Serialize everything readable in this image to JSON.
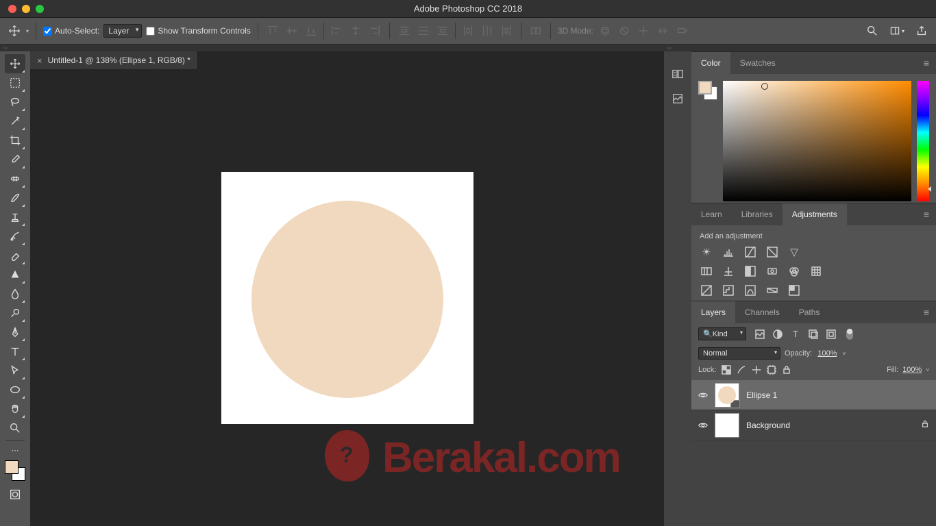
{
  "app": {
    "title": "Adobe Photoshop CC 2018"
  },
  "optionsBar": {
    "autoSelect": "Auto-Select:",
    "autoSelectMode": "Layer",
    "showTransform": "Show Transform Controls",
    "threeDMode": "3D Mode:"
  },
  "document": {
    "tabTitle": "Untitled-1 @ 138% (Ellipse 1, RGB/8) *"
  },
  "colors": {
    "foreground": "#f1d9bf",
    "background": "#ffffff"
  },
  "panels": {
    "color": {
      "tab1": "Color",
      "tab2": "Swatches"
    },
    "adjustments": {
      "tab1": "Learn",
      "tab2": "Libraries",
      "tab3": "Adjustments",
      "addLabel": "Add an adjustment"
    },
    "layers": {
      "tab1": "Layers",
      "tab2": "Channels",
      "tab3": "Paths",
      "filterKind": "Kind",
      "blendMode": "Normal",
      "opacityLabel": "Opacity:",
      "opacityValue": "100%",
      "lockLabel": "Lock:",
      "fillLabel": "Fill:",
      "fillValue": "100%",
      "items": [
        {
          "name": "Ellipse 1",
          "selected": true,
          "locked": false
        },
        {
          "name": "Background",
          "selected": false,
          "locked": true
        }
      ]
    }
  },
  "watermark": {
    "text": "Berakal.com"
  },
  "searchFilter": "Kind"
}
